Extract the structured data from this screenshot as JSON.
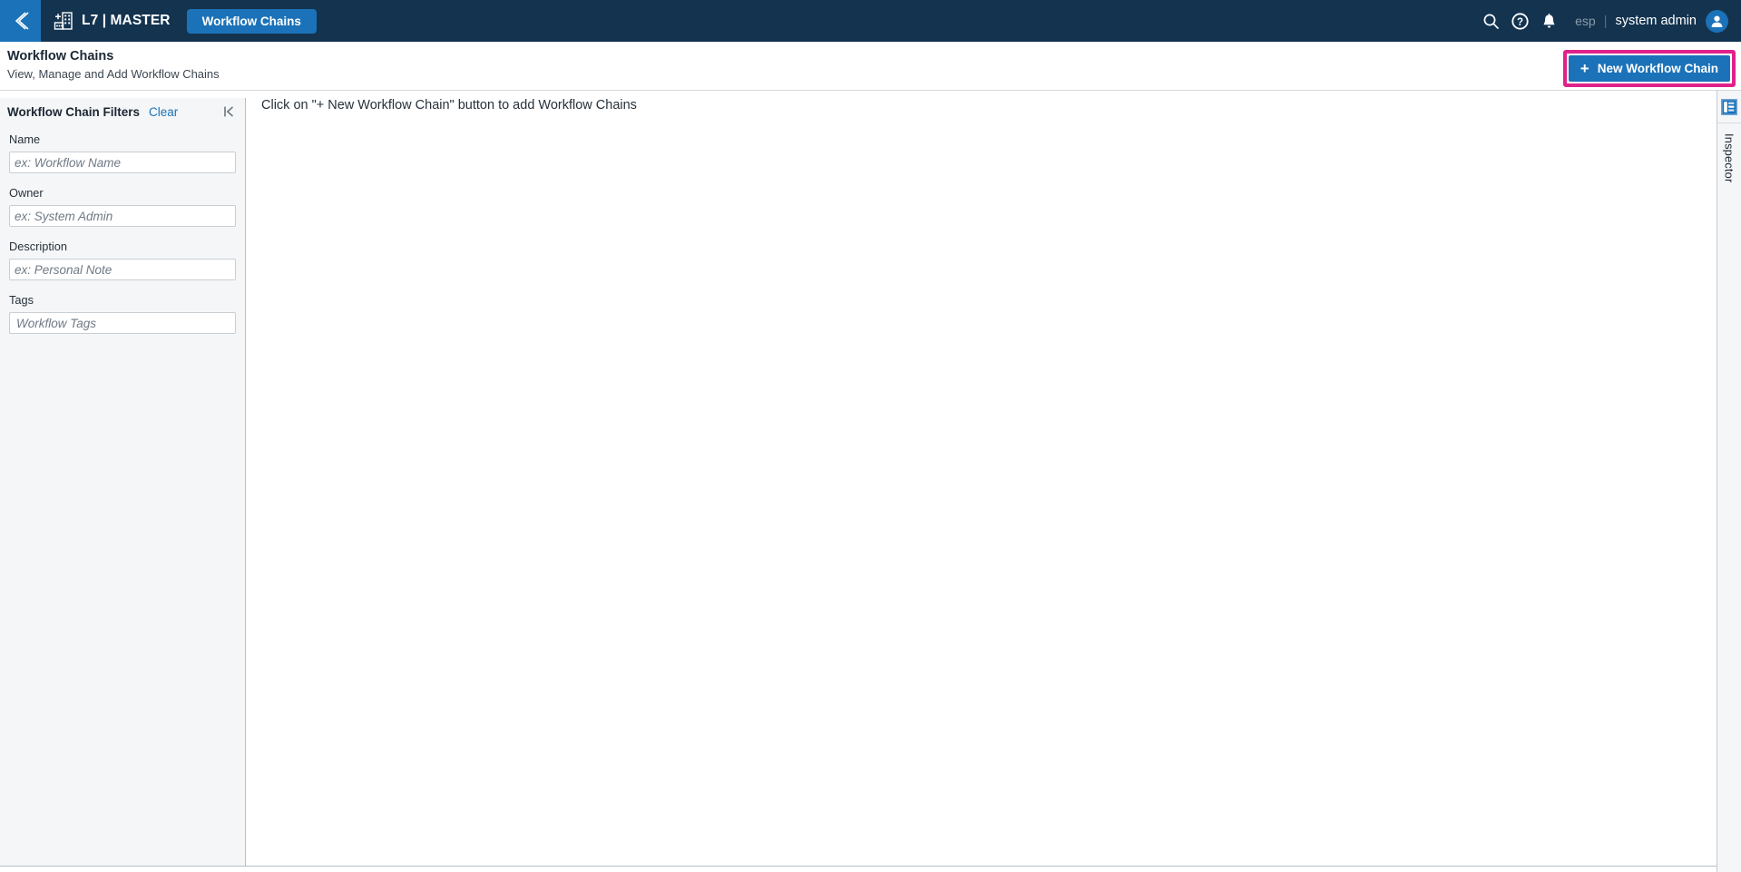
{
  "topbar": {
    "back_icon": "chevron-left-icon",
    "brand_icon": "facility-add-icon",
    "brand_name": "L7 | MASTER",
    "active_tab": "Workflow Chains",
    "search_icon": "search-icon",
    "help_icon": "help-circle-icon",
    "notifications_icon": "bell-icon",
    "language": "esp",
    "divider": "|",
    "username": "system admin",
    "avatar_icon": "user-avatar-icon",
    "bg_color": "#13334f",
    "accent_color": "#1b72b8"
  },
  "page_header": {
    "title": "Workflow Chains",
    "subtitle": "View, Manage and Add Workflow Chains",
    "new_button": {
      "plus": "+",
      "label": "New Workflow Chain",
      "highlight_color": "#e0218a",
      "button_color": "#1b72b8"
    }
  },
  "sidebar": {
    "title": "Workflow Chain Filters",
    "clear_label": "Clear",
    "collapse_icon": "collapse-panel-left-icon",
    "fields": [
      {
        "label": "Name",
        "placeholder": "ex: Workflow Name",
        "value": ""
      },
      {
        "label": "Owner",
        "placeholder": "ex: System Admin",
        "value": ""
      },
      {
        "label": "Description",
        "placeholder": "ex: Personal Note",
        "value": ""
      },
      {
        "label": "Tags",
        "placeholder": "Workflow Tags",
        "value": ""
      }
    ]
  },
  "main": {
    "empty_message": "Click on \"+ New Workflow Chain\" button to add Workflow Chains"
  },
  "inspector": {
    "icon": "inspector-panel-icon",
    "label": "Inspector"
  }
}
